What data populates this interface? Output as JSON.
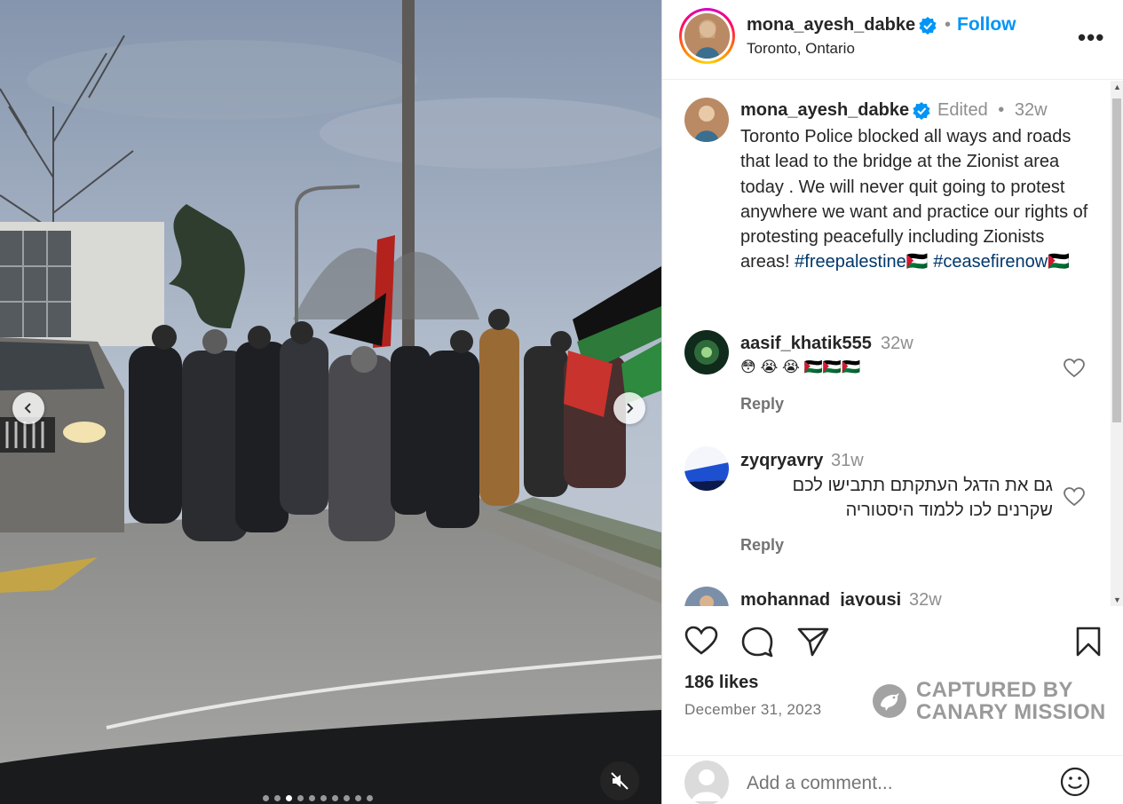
{
  "header": {
    "username": "mona_ayesh_dabke",
    "separator": "•",
    "follow_label": "Follow",
    "location": "Toronto, Ontario",
    "more_label": "•••"
  },
  "caption": {
    "username": "mona_ayesh_dabke",
    "edited": "Edited",
    "separator": "•",
    "time": "32w",
    "text": "Toronto Police blocked all ways and roads that lead to the bridge at the Zionist area today . We will never quit going to protest anywhere we want and practice our rights of protesting peacefully including Zionists areas!",
    "hashtags": "#freepalestine🇵🇸 #ceasefirenow🇵🇸"
  },
  "comments": [
    {
      "username": "aasif_khatik555",
      "time": "32w",
      "text": "😳 😭 😭 🇵🇸🇵🇸🇵🇸",
      "reply_label": "Reply"
    },
    {
      "username": "zyqryavry",
      "time": "31w",
      "text_line1": "גם את הדגל העתקתם תתבישו לכם",
      "text_line2": "שקרנים לכו ללמוד היסטוריה",
      "reply_label": "Reply"
    },
    {
      "username": "mohannad_jayousi",
      "time": "32w"
    }
  ],
  "post": {
    "likes": "186 likes",
    "date": "December 31, 2023",
    "comment_placeholder": "Add a comment..."
  },
  "watermark": {
    "line1": "CAPTURED BY",
    "line2": "CANARY MISSION"
  },
  "carousel": {
    "slide_count": 10,
    "active_index": 2
  },
  "colors": {
    "accent": "#0095f6",
    "hashtag": "#00376b",
    "secondary_text": "#8e8e8e"
  }
}
